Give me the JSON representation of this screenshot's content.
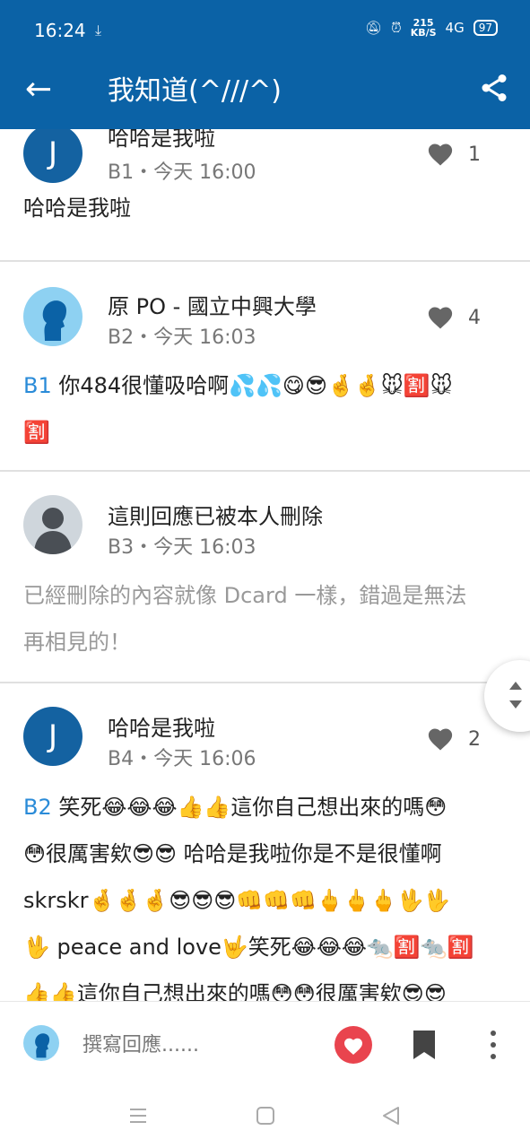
{
  "status_bar": {
    "time": "16:24",
    "speed_value": "215",
    "speed_unit": "KB/S",
    "network": "4G",
    "battery": "97"
  },
  "app_bar": {
    "title": "我知道(^///^)",
    "back_icon": "arrow-left-icon",
    "share_icon": "share-icon"
  },
  "posts": [
    {
      "avatar_letter": "J",
      "name": "哈哈是我啦",
      "meta": "B1・今天 16:00",
      "likes": "1",
      "body": "哈哈是我啦"
    },
    {
      "name": "原 PO - 國立中興大學",
      "meta": "B2・今天 16:03",
      "likes": "4",
      "ref": "B1",
      "body_line1": " 你484很懂吸哈啊💦💦😋😎🤞🤞🐭🈹🐭",
      "body_line2": "🈹"
    },
    {
      "name": "這則回應已被本人刪除",
      "meta": "B3・今天 16:03",
      "body_line1": "已經刪除的內容就像 Dcard 一樣，錯過是無法",
      "body_line2": "再相見的！"
    },
    {
      "avatar_letter": "J",
      "name": "哈哈是我啦",
      "meta": "B4・今天 16:06",
      "likes": "2",
      "ref": "B2",
      "lines": [
        " 笑死😂😂😂👍👍這你自己想出來的嗎😳",
        "😳很厲害欸😎😎 哈哈是我啦你是不是很懂啊",
        "skrskr🤞🤞🤞😎😎😎👊👊👊🖕🖕🖕🖖🖖",
        "🖖 peace and love🤟笑死😂😂😂🐀🈹🐀🈹",
        "👍👍這你自己想出來的嗎😳😳很厲害欸😎😎"
      ]
    }
  ],
  "composer": {
    "placeholder": "撰寫回應......"
  },
  "colors": {
    "brand": "#0b62a6",
    "reply_ref": "#2a8bd8",
    "heart_active": "#e9444e"
  }
}
